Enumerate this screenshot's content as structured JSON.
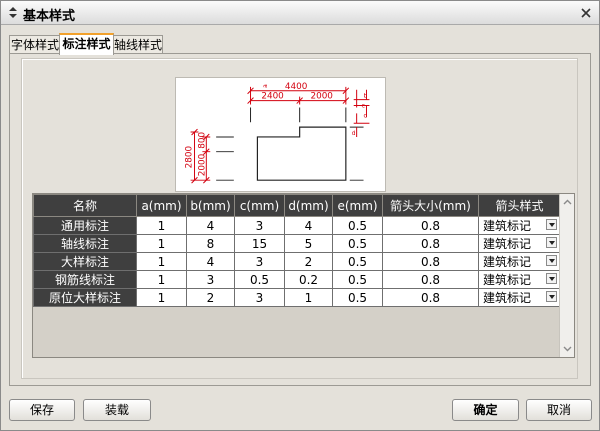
{
  "window": {
    "title": "基本样式"
  },
  "tabs": [
    {
      "label": "字体样式",
      "active": false
    },
    {
      "label": "标注样式",
      "active": true
    },
    {
      "label": "轴线样式",
      "active": false
    }
  ],
  "preview": {
    "labels": {
      "top_total": "4400",
      "top_left": "2400",
      "top_right": "2000",
      "left_total": "2800",
      "left_lower": "2000",
      "left_upper": "800",
      "tick_a": "a",
      "tick_b": "b",
      "tick_c": "c",
      "tick_d": "d",
      "tick_e": "e"
    }
  },
  "table": {
    "headers": [
      "名称",
      "a(mm)",
      "b(mm)",
      "c(mm)",
      "d(mm)",
      "e(mm)",
      "箭头大小(mm)",
      "箭头样式"
    ],
    "rows": [
      {
        "name": "通用标注",
        "a": "1",
        "b": "4",
        "c": "3",
        "d": "4",
        "e": "0.5",
        "arrow_size": "0.8",
        "arrow_style": "建筑标记"
      },
      {
        "name": "轴线标注",
        "a": "1",
        "b": "8",
        "c": "15",
        "d": "5",
        "e": "0.5",
        "arrow_size": "0.8",
        "arrow_style": "建筑标记"
      },
      {
        "name": "大样标注",
        "a": "1",
        "b": "4",
        "c": "3",
        "d": "2",
        "e": "0.5",
        "arrow_size": "0.8",
        "arrow_style": "建筑标记"
      },
      {
        "name": "钢筋线标注",
        "a": "1",
        "b": "3",
        "c": "0.5",
        "d": "0.2",
        "e": "0.5",
        "arrow_size": "0.8",
        "arrow_style": "建筑标记"
      },
      {
        "name": "原位大样标注",
        "a": "1",
        "b": "2",
        "c": "3",
        "d": "1",
        "e": "0.5",
        "arrow_size": "0.8",
        "arrow_style": "建筑标记"
      }
    ]
  },
  "buttons": {
    "save": "保存",
    "load": "装载",
    "ok": "确定",
    "cancel": "取消"
  },
  "icons": {
    "title": "diamond-arrows-icon",
    "close": "close-icon",
    "dropdown": "chevron-down-icon"
  },
  "colors": {
    "accent_tab": "#f2a12c",
    "dimension": "#d3000e",
    "header_bg": "#3f3f3f"
  }
}
